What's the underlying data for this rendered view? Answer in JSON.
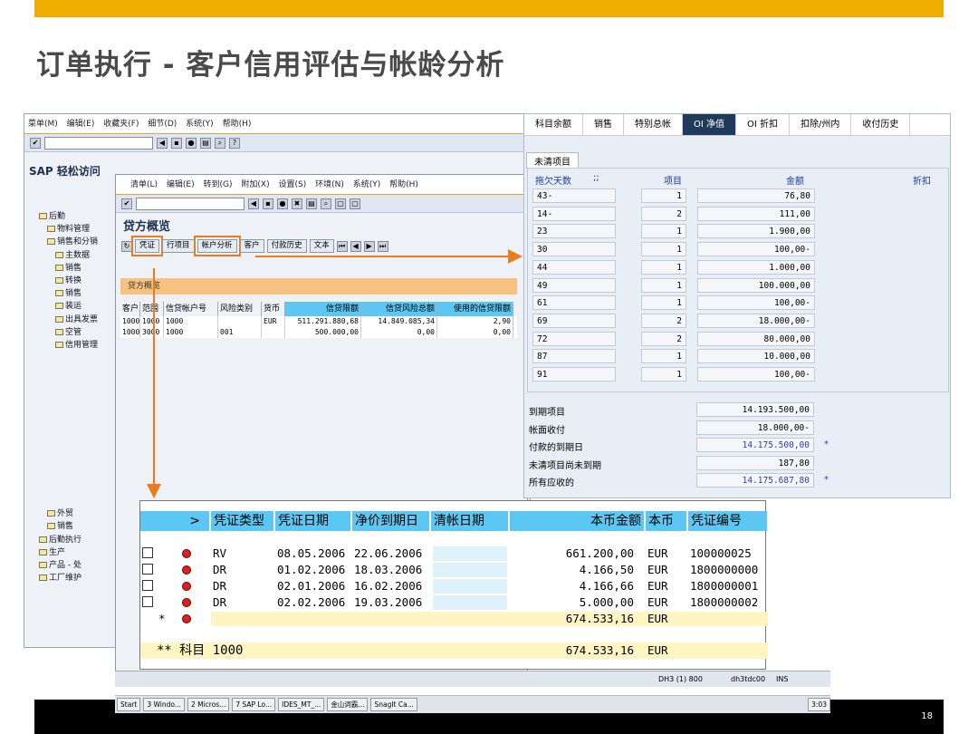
{
  "slide": {
    "title": "订单执行 - 客户信用评估与帐龄分析",
    "page_number": "18"
  },
  "back_window": {
    "menu": [
      "菜单(M)",
      "编辑(E)",
      "收藏夹(F)",
      "细节(D)",
      "系统(Y)",
      "帮助(H)"
    ],
    "easy_access": "SAP 轻松访问",
    "tree": [
      "后勤",
      "物料管理",
      "销售和分销",
      "主数据",
      "销售",
      "转换",
      "销售",
      "装运",
      "出具发票",
      "空管",
      "信用管理",
      "外贸",
      "销售",
      "后勤执行",
      "生产",
      "产品 - 处",
      "工厂维护"
    ]
  },
  "mid_window": {
    "menu": [
      "清单(L)",
      "编辑(E)",
      "转到(G)",
      "附加(X)",
      "设置(S)",
      "环境(N)",
      "系统(Y)",
      "帮助(H)"
    ],
    "title": "贷方概览",
    "buttons": [
      "凭证",
      "行项目",
      "帐户分析",
      "客户",
      "付款历史",
      "文本"
    ],
    "panel_title": "贷方概览",
    "columns": [
      "客户",
      "范围",
      "信贷帐户号",
      "风险类别",
      "货币",
      "信贷限额",
      "信贷风险总额",
      "使用的信贷限额"
    ],
    "rows": [
      [
        "1000",
        "1000",
        "1000",
        "",
        "EUR",
        "511.291.880,68",
        "14.849.085,34",
        "2,90"
      ],
      [
        "1000",
        "3000",
        "1000",
        "001",
        "",
        "500.000,00",
        "0,00",
        "0,00"
      ]
    ]
  },
  "right_panel": {
    "tabs": [
      "科目余额",
      "销售",
      "特别总帐",
      "OI 净值",
      "OI 折扣",
      "扣除/州内",
      "收付历史"
    ],
    "active_tab": "OI 净值",
    "group_label": "未清项目",
    "headers": [
      "拖欠天数",
      ";;",
      "项目",
      "金额",
      "折扣"
    ],
    "rows": [
      [
        "43-",
        "1",
        "76,80"
      ],
      [
        "14-",
        "2",
        "111,00"
      ],
      [
        "23",
        "1",
        "1.900,00"
      ],
      [
        "30",
        "1",
        "100,00-"
      ],
      [
        "44",
        "1",
        "1.000,00"
      ],
      [
        "49",
        "1",
        "100.000,00"
      ],
      [
        "61",
        "1",
        "100,00-"
      ],
      [
        "69",
        "2",
        "18.000,00-"
      ],
      [
        "72",
        "2",
        "80.000,00"
      ],
      [
        "87",
        "1",
        "10.000,00"
      ],
      [
        "91",
        "1",
        "100,00-"
      ]
    ],
    "summary": [
      {
        "label": "到期项目",
        "value": "14.193.500,00",
        "mark": ""
      },
      {
        "label": "帐面收付",
        "value": "18.000,00-",
        "mark": ""
      },
      {
        "label": "付款的到期日",
        "value": "14.175.500,00",
        "mark": "*"
      },
      {
        "label": "未清项目尚未到期",
        "value": "187,80",
        "mark": ""
      },
      {
        "label": "所有应收的",
        "value": "14.175.687,80",
        "mark": "*"
      }
    ]
  },
  "doc_list": {
    "headers": [
      ">",
      "凭证类型",
      "凭证日期",
      "净价到期日",
      "清帐日期",
      "本币金额",
      "本币",
      "凭证编号"
    ],
    "rows": [
      [
        "RV",
        "08.05.2006",
        "22.06.2006",
        "",
        "661.200,00",
        "EUR",
        "100000025"
      ],
      [
        "DR",
        "01.02.2006",
        "18.03.2006",
        "",
        "4.166,50",
        "EUR",
        "1800000000"
      ],
      [
        "DR",
        "02.01.2006",
        "16.02.2006",
        "",
        "4.166,66",
        "EUR",
        "1800000001"
      ],
      [
        "DR",
        "02.02.2006",
        "19.03.2006",
        "",
        "5.000,00",
        "EUR",
        "1800000002"
      ]
    ],
    "subtotal": {
      "star": "*",
      "amount": "674.533,16",
      "currency": "EUR"
    },
    "total": {
      "label": "** 科目 1000",
      "amount": "674.533,16",
      "currency": "EUR"
    }
  },
  "status_bar": {
    "system": "DH3 (1) 800",
    "host": "dh3tdc00",
    "mode": "INS"
  },
  "taskbar": {
    "items": [
      "Start",
      "3 Windo...",
      "2 Micros...",
      "7 SAP Lo...",
      "IDES_MT_...",
      "金山词霸...",
      "SnagIt Ca..."
    ],
    "clock": "3:03"
  },
  "colors": {
    "accent_bar": "#f0ad00",
    "highlight": "#ec7a1e",
    "column_header": "#5cc7f2"
  }
}
